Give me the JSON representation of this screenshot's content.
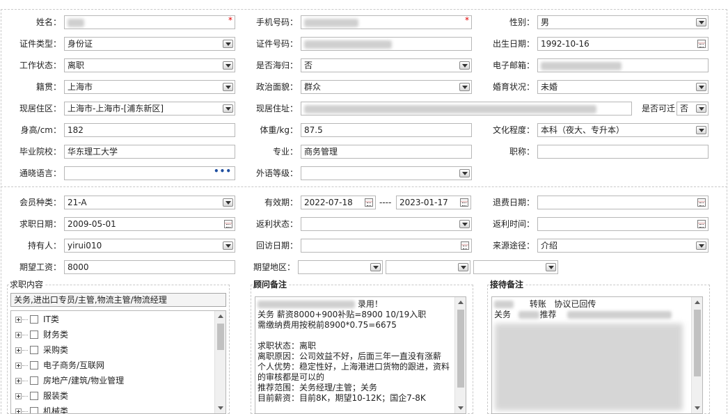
{
  "form": {
    "row1": {
      "name_label": "姓名：",
      "name_value": "",
      "phone_label": "手机号码：",
      "phone_value": "",
      "gender_label": "性别：",
      "gender_value": "男"
    },
    "row2": {
      "id_type_label": "证件类型：",
      "id_type_value": "身份证",
      "id_no_label": "证件号码：",
      "id_no_value": "",
      "birth_label": "出生日期：",
      "birth_value": "1992-10-16"
    },
    "row3": {
      "work_label": "工作状态：",
      "work_value": "离职",
      "overseas_label": "是否海归：",
      "overseas_value": "否",
      "email_label": "电子邮箱：",
      "email_value": ""
    },
    "row4": {
      "native_label": "籍贯：",
      "native_value": "上海市",
      "political_label": "政治面貌：",
      "political_value": "群众",
      "marital_label": "婚育状况：",
      "marital_value": "未婚"
    },
    "row5": {
      "current_area_label": "现居住区：",
      "current_area_value": "上海市-上海市-[浦东新区]",
      "current_addr_label": "现居住址：",
      "current_addr_value": "",
      "relocate_label": "是否可迁",
      "relocate_value": "否"
    },
    "row6": {
      "height_label": "身高/cm：",
      "height_value": "182",
      "weight_label": "体重/kg：",
      "weight_value": "87.5",
      "edu_label": "文化程度：",
      "edu_value": "本科（夜大、专升本）"
    },
    "row7": {
      "school_label": "毕业院校：",
      "school_value": "华东理工大学",
      "major_label": "专业：",
      "major_value": "商务管理",
      "title_label": "职称：",
      "title_value": ""
    },
    "row8": {
      "lang_label": "通晓语言：",
      "lang_value": "",
      "foreign_label": "外语等级：",
      "foreign_value": ""
    }
  },
  "membership": {
    "type_label": "会员种类：",
    "type_value": "21-A",
    "valid_label": "有效期：",
    "valid_from": "2022-07-18",
    "valid_sep": "----",
    "valid_to": "2023-01-17",
    "refund_label": "退费日期：",
    "refund_value": "",
    "job_date_label": "求职日期：",
    "job_date_value": "2009-05-01",
    "rebate_status_label": "返利状态：",
    "rebate_status_value": "",
    "rebate_time_label": "返利时间：",
    "rebate_time_value": "",
    "holder_label": "持有人：",
    "holder_value": "yirui010",
    "visit_label": "回访日期：",
    "visit_value": "",
    "source_label": "来源途径：",
    "source_value": "介绍",
    "salary_label": "期望工资：",
    "salary_value": "8000",
    "region_label": "期望地区：",
    "region_values": [
      "",
      "",
      ""
    ]
  },
  "job_panel": {
    "title": "求职内容",
    "summary": "关务,进出口专员/主管,物流主管/物流经理",
    "tree": [
      {
        "label": "IT类"
      },
      {
        "label": "财务类"
      },
      {
        "label": "采购类"
      },
      {
        "label": "电子商务/互联网"
      },
      {
        "label": "房地产/建筑/物业管理"
      },
      {
        "label": "服装类"
      },
      {
        "label": "机械类"
      }
    ]
  },
  "advisor_panel": {
    "title": "顾问备注",
    "line1_suffix": "录用！",
    "body": "关务 薪资8000+900补贴=8900 10/19入职\n需缴纳费用按税前8900*0.75=6675\n\n求职状态：离职\n离职原因：公司效益不好，后面三年一直没有涨薪\n个人优势：稳定性好，上海港进口货物的跟进，资料\n的审核都是可以的\n推荐范围：关务经理/主管；关务\n目前薪资：目前8K，期望10-12K；国企7-8K"
  },
  "reception_panel": {
    "title": "接待备注",
    "line1_mid": "转账",
    "line1_end": "协议已回传",
    "line2_start": "关务",
    "line2_end": "推荐"
  },
  "colors": {
    "required_star": "#e00000",
    "ellipsis": "#1f4fa0",
    "border": "#b7b7b7"
  }
}
